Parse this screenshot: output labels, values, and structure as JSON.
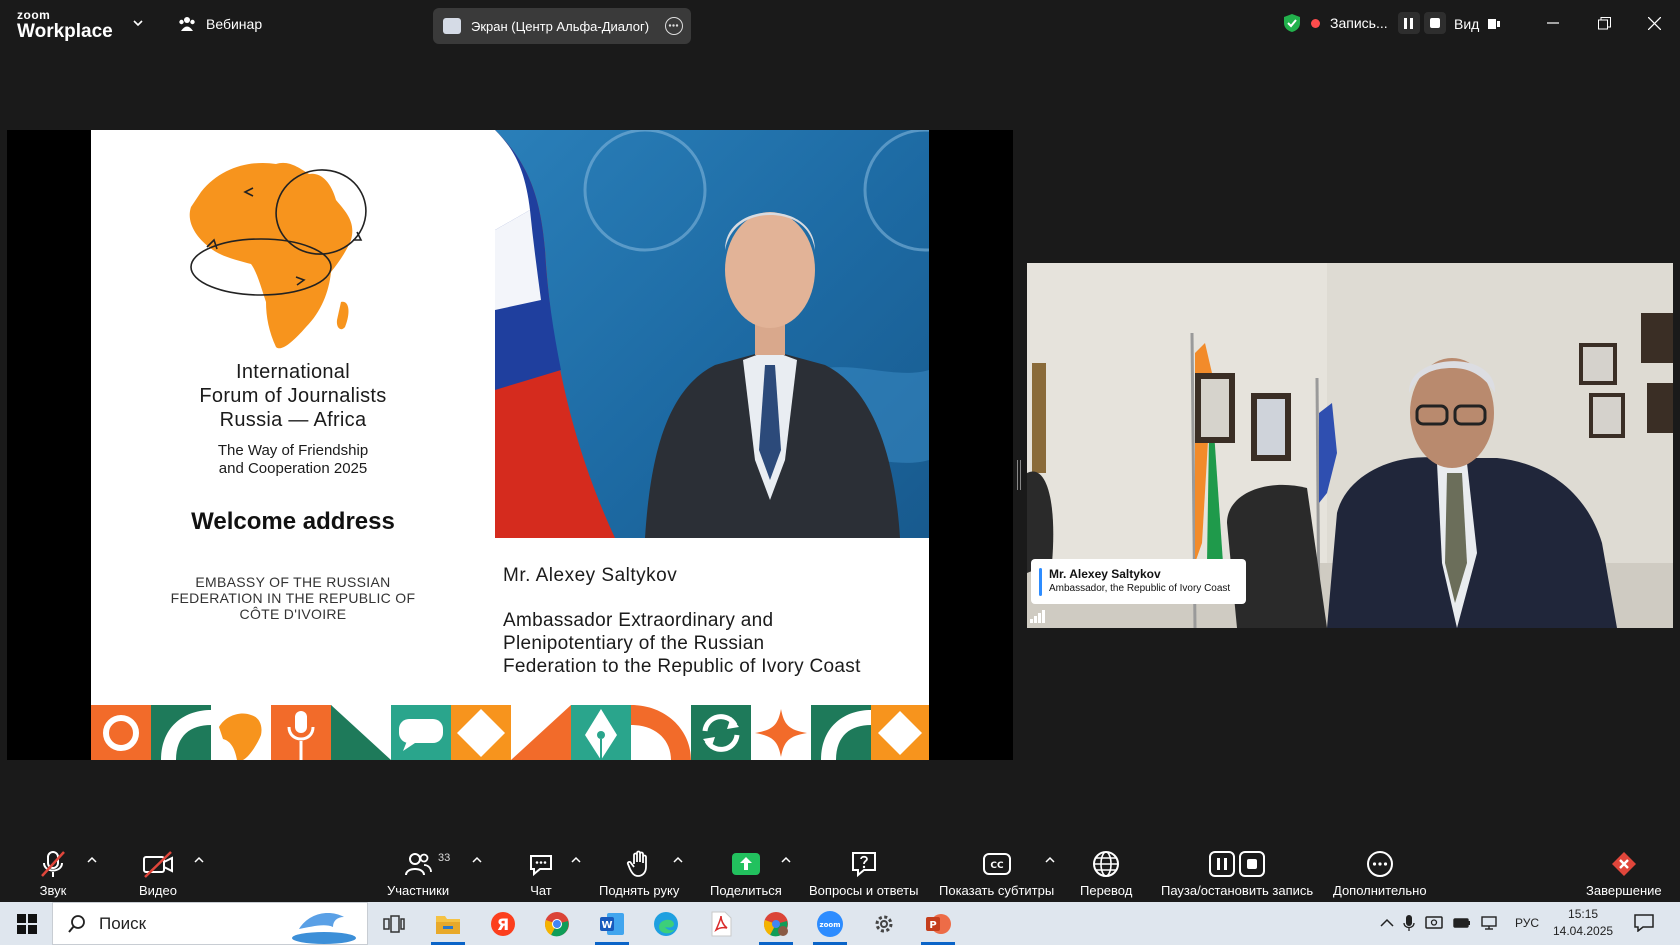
{
  "topbar": {
    "brand_small": "zoom",
    "brand_large": "Workplace",
    "meeting_type": "Вебинар",
    "screen_share_label": "Экран (Центр Альфа-Диалог)",
    "recording_label": "Запись...",
    "view_label": "Вид",
    "recording_color": "#ff4d4d",
    "security_color": "#22b14c"
  },
  "slide": {
    "forum_title_line1": "International",
    "forum_title_line2": "Forum of Journalists",
    "forum_title_line3": "Russia — Africa",
    "subtitle_line1": "The Way of Friendship",
    "subtitle_line2": "and Cooperation 2025",
    "welcome": "Welcome address",
    "embassy_line1": "EMBASSY OF THE RUSSIAN",
    "embassy_line2": "FEDERATION IN THE REPUBLIC OF",
    "embassy_line3": "CÔTE D'IVOIRE",
    "speaker_name": "Mr. Alexey Saltykov",
    "speaker_role_line1": "Ambassador Extraordinary and",
    "speaker_role_line2": "Plenipotentiary of the Russian",
    "speaker_role_line3": "Federation to the Republic of Ivory Coast",
    "accent_orange": "#f7941d",
    "accent_green": "#1e7a5a"
  },
  "video": {
    "participant_name": "Mr. Alexey Saltykov",
    "participant_title": "Ambassador, the Republic of Ivory Coast"
  },
  "toolbar": {
    "audio": "Звук",
    "video": "Видео",
    "participants": "Участники",
    "participants_count": "33",
    "chat": "Чат",
    "raise_hand": "Поднять руку",
    "share": "Поделиться",
    "qa": "Вопросы и ответы",
    "captions": "Показать субтитры",
    "translation": "Перевод",
    "pause_stop_recording": "Пауза/остановить запись",
    "more": "Дополнительно",
    "end": "Завершение",
    "share_color": "#22c15e",
    "end_color": "#e0463b"
  },
  "taskbar": {
    "search_placeholder": "Поиск",
    "language": "РУС",
    "time": "15:15",
    "date": "14.04.2025"
  }
}
